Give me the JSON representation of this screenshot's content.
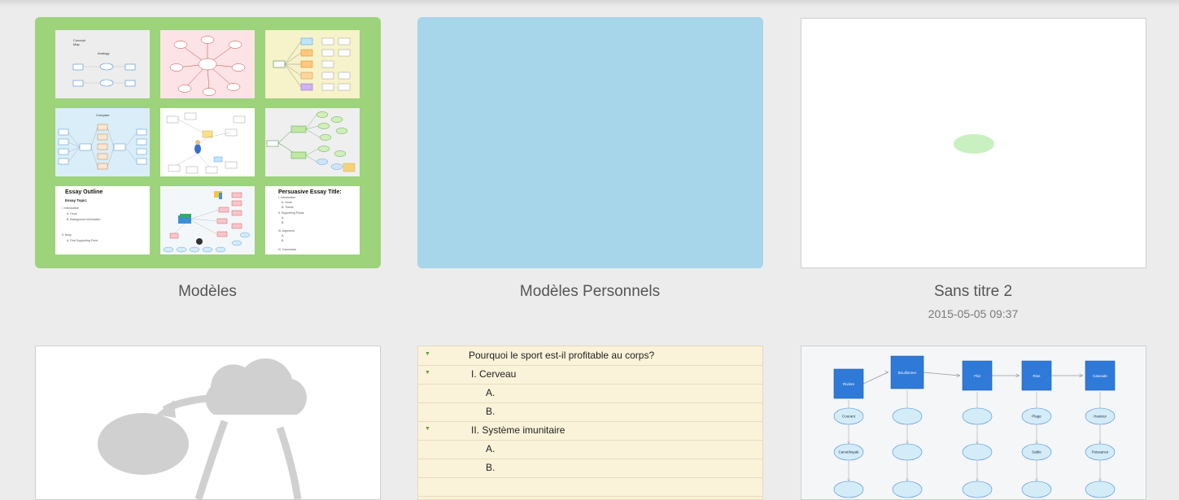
{
  "colors": {
    "models_bg": "#9dd37a",
    "personal_bg": "#a7d5ea",
    "outline_bg": "#faf2d9",
    "flow_box": "#2f7ad9",
    "flow_oval": "#d3ecf8"
  },
  "tiles": {
    "models": {
      "label": "Modèles"
    },
    "personal": {
      "label": "Modèles Personnels"
    },
    "sans_titre": {
      "label": "Sans titre 2",
      "date": "2015-05-05 09:37"
    }
  },
  "thumbnails": {
    "essay_outline": {
      "title": "Essay Outline",
      "subtitle": "Essay Topic:",
      "lines": [
        "I. Introduction",
        "A. Hook",
        "B. Background Information",
        "II. Body",
        "A. First Supporting Point"
      ]
    },
    "persuasive": {
      "title": "Persuasive Essay Title:",
      "lines": [
        "I. Introduction",
        "A. Hook",
        "B. Thesis",
        "II. Supporting Points",
        "A.",
        "B.",
        "III. Argument",
        "A.",
        "B.",
        "IV. Conclusion"
      ]
    }
  },
  "outline": {
    "rows": [
      {
        "text": "Pourquoi le sport est-il profitable au corps?",
        "level": 0,
        "expandable": true
      },
      {
        "text": "I. Cerveau",
        "level": 1,
        "expandable": true
      },
      {
        "text": "A.",
        "level": 2,
        "expandable": false
      },
      {
        "text": "B.",
        "level": 2,
        "expandable": false
      },
      {
        "text": "II. Système imunitaire",
        "level": 1,
        "expandable": true
      },
      {
        "text": "A.",
        "level": 2,
        "expandable": false
      },
      {
        "text": "B.",
        "level": 2,
        "expandable": false
      }
    ]
  },
  "flow": {
    "boxes": [
      "Rivière",
      "Bouillonner",
      "Flot",
      "Rive",
      "Cascade"
    ],
    "ovals_row1": [
      "Courant",
      "",
      "",
      "Plage",
      "Hauteur"
    ],
    "ovals_row2": [
      "Canot/kayak",
      "",
      "",
      "Sable",
      "Puissance"
    ]
  }
}
